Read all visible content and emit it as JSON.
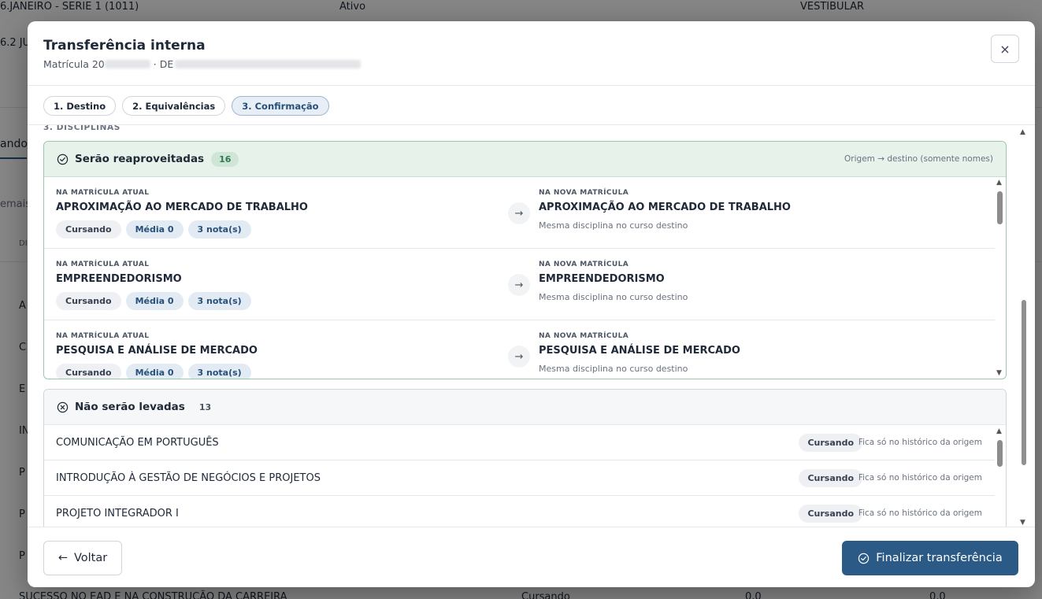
{
  "background": {
    "row1": {
      "name": "6.JANEIRO - SERIE 1 (1011)",
      "status": "Ativo",
      "type": "VESTIBULAR"
    },
    "row2_prefix": "6.2 JU",
    "tab_fragment": "ando",
    "filter_fragment": "emais",
    "header_fragment": "DI",
    "list_initials": [
      "A",
      "C",
      "E",
      "IN",
      "P",
      "P",
      "P"
    ],
    "bottom_row": {
      "name": "SUCESSO NO EAD E NA CONSTRUÇÃO DA CARREIRA",
      "status": "Cursando",
      "v1": "0,0",
      "v2": "0,0"
    }
  },
  "modal": {
    "title": "Transferência interna",
    "subtitle_prefix": "Matrícula 20",
    "subtitle_sep": "· DE",
    "close_label": "×",
    "steps": [
      {
        "label": "1. Destino",
        "active": false
      },
      {
        "label": "2. Equivalências",
        "active": false
      },
      {
        "label": "3. Confirmação",
        "active": true
      }
    ],
    "section_label": "3. DISCIPLINAS",
    "reaproveitadas": {
      "title": "Serão reaproveitadas",
      "count": "16",
      "note": "Origem → destino (somente nomes)",
      "left_label": "NA MATRÍCULA ATUAL",
      "right_label": "NA NOVA MATRÍCULA",
      "arrow": "→",
      "items": [
        {
          "origin": "APROXIMAÇÃO AO MERCADO DE TRABALHO",
          "status": "Cursando",
          "media": "Média 0",
          "notas": "3 nota(s)",
          "destination": "APROXIMAÇÃO AO MERCADO DE TRABALHO",
          "hint": "Mesma disciplina no curso destino"
        },
        {
          "origin": "EMPREENDEDORISMO",
          "status": "Cursando",
          "media": "Média 0",
          "notas": "3 nota(s)",
          "destination": "EMPREENDEDORISMO",
          "hint": "Mesma disciplina no curso destino"
        },
        {
          "origin": "PESQUISA E ANÁLISE DE MERCADO",
          "status": "Cursando",
          "media": "Média 0",
          "notas": "3 nota(s)",
          "destination": "PESQUISA E ANÁLISE DE MERCADO",
          "hint": "Mesma disciplina no curso destino"
        }
      ]
    },
    "nao_levadas": {
      "title": "Não serão levadas",
      "count": "13",
      "items": [
        {
          "name": "COMUNICAÇÃO EM PORTUGUÊS",
          "status": "Cursando",
          "note": "Fica só no histórico da origem"
        },
        {
          "name": "INTRODUÇÃO À GESTÃO DE NEGÓCIOS E PROJETOS",
          "status": "Cursando",
          "note": "Fica só no histórico da origem"
        },
        {
          "name": "PROJETO INTEGRADOR I",
          "status": "Cursando",
          "note": "Fica só no histórico da origem"
        }
      ]
    },
    "footer": {
      "back_label": "Voltar",
      "back_icon": "←",
      "finish_label": "Finalizar transferência"
    }
  },
  "colors": {
    "accent": "#2b5a86",
    "success_bg": "#e6f2ea",
    "success_border": "#9bc7ad"
  }
}
